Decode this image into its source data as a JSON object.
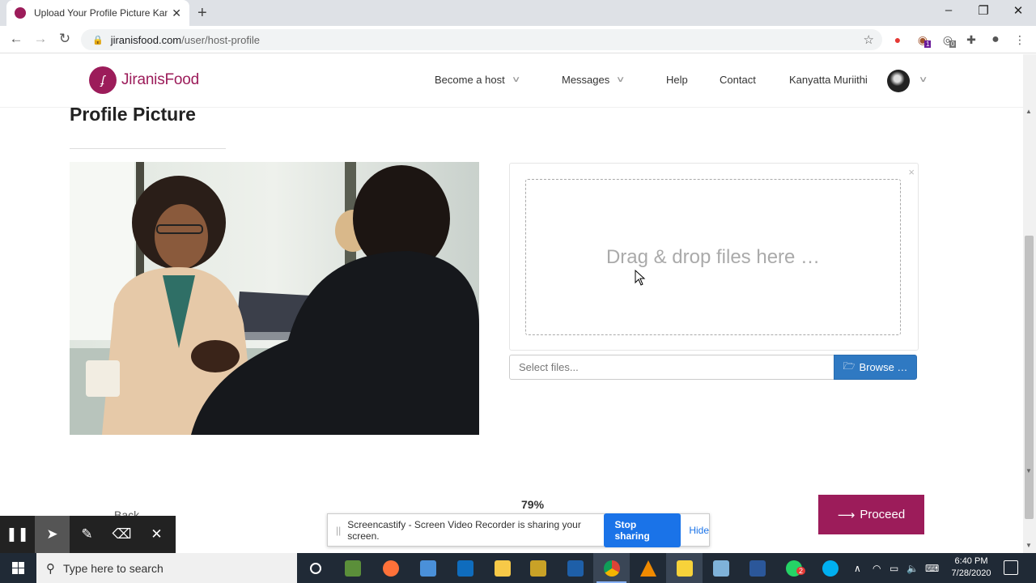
{
  "browser": {
    "tab_title": "Upload Your Profile Picture Kanyatta",
    "url_domain": "jiranisfood.com",
    "url_path": "/user/host-profile",
    "ext_badge_1": "1",
    "ext_badge_2": "0"
  },
  "header": {
    "logo_text": "JiranisFood",
    "nav": {
      "become_host": "Become a host",
      "messages": "Messages",
      "help": "Help",
      "contact": "Contact",
      "user_name": "Kanyatta Muriithi"
    }
  },
  "main": {
    "page_title": "Profile Picture",
    "drop_zone_text": "Drag & drop files here …",
    "file_input_placeholder": "Select files...",
    "browse_label": "Browse …",
    "progress_text": "79%",
    "back_label": "Back",
    "proceed_label": "Proceed"
  },
  "screencastify": {
    "banner_message": "Screencastify - Screen Video Recorder is sharing your screen.",
    "stop_label": "Stop sharing",
    "hide_label": "Hide"
  },
  "taskbar": {
    "search_placeholder": "Type here to search",
    "time": "6:40 PM",
    "date": "7/28/2020",
    "whatsapp_badge": "2"
  },
  "colors": {
    "brand": "#9c1c5a",
    "browse_blue": "#2f79c2",
    "stop_blue": "#1a73e8"
  }
}
